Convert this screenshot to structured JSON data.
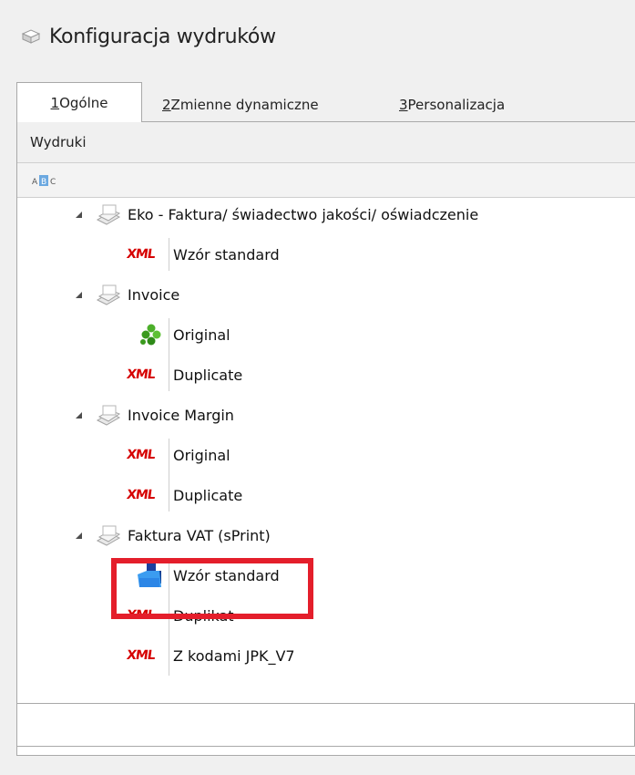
{
  "window": {
    "title": "Konfiguracja wydruków"
  },
  "tabs": [
    {
      "number": "1",
      "label": " Ogólne"
    },
    {
      "number": "2",
      "label": " Zmienne dynamiczne"
    },
    {
      "number": "3",
      "label": " Personalizacja"
    }
  ],
  "section": {
    "header": "Wydruki"
  },
  "toolbar": {
    "sort_icon": "abc-sort-icon"
  },
  "tree": {
    "groups": [
      {
        "label": "Eko - Faktura/ świadectwo jakości/ oświadczenie",
        "icon": "printer-doc-icon",
        "items": [
          {
            "label": "Wzór standard",
            "icon": "xml-icon"
          }
        ]
      },
      {
        "label": "Invoice",
        "icon": "printer-doc-icon",
        "items": [
          {
            "label": "Original",
            "icon": "green-clover-icon"
          },
          {
            "label": "Duplicate",
            "icon": "xml-icon"
          }
        ]
      },
      {
        "label": "Invoice Margin",
        "icon": "printer-doc-icon",
        "items": [
          {
            "label": "Original",
            "icon": "xml-icon"
          },
          {
            "label": "Duplicate",
            "icon": "xml-icon"
          }
        ]
      },
      {
        "label": "Faktura VAT (sPrint)",
        "icon": "printer-doc-icon",
        "items": [
          {
            "label": "Wzór standard",
            "icon": "blue-sprint-icon"
          },
          {
            "label": "Duplikat",
            "icon": "xml-icon"
          },
          {
            "label": "Z kodami JPK_V7",
            "icon": "xml-icon"
          }
        ]
      }
    ]
  },
  "xml_text": "XML",
  "colors": {
    "highlight": "#e41e2b",
    "xml": "#d60000",
    "panel_border": "#a9a9a9"
  }
}
